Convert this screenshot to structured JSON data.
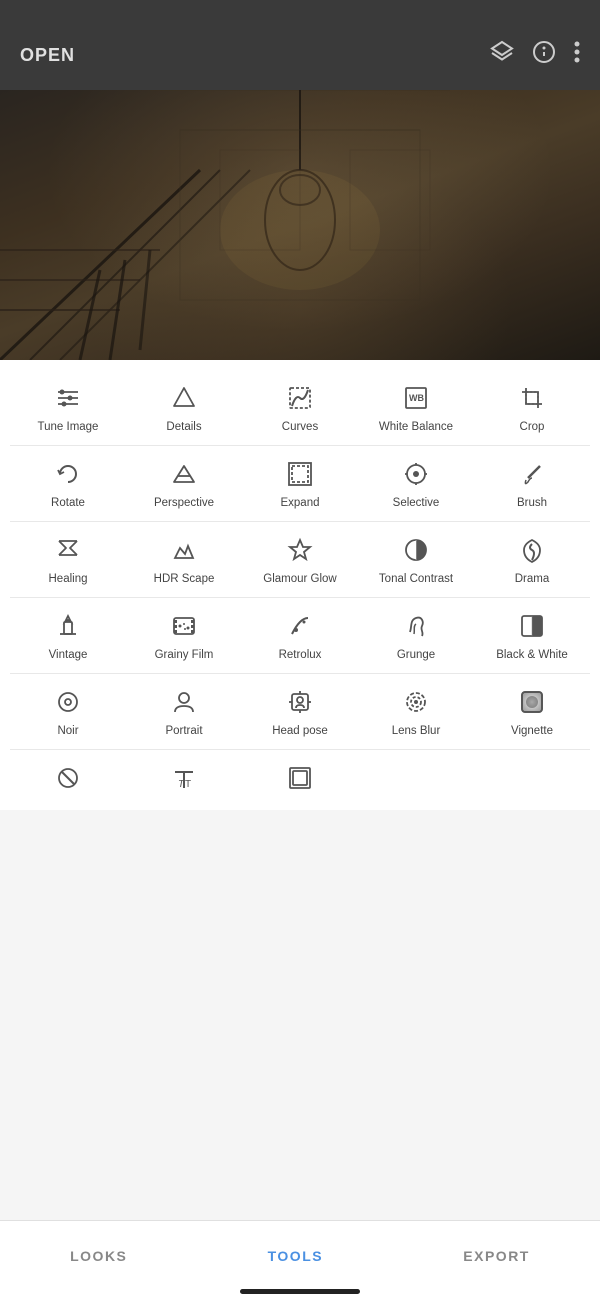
{
  "header": {
    "open_label": "OPEN",
    "layers_icon": "layers",
    "info_icon": "info",
    "more_icon": "more"
  },
  "bottom_nav": {
    "looks": "LOOKS",
    "tools": "TOOLS",
    "export": "EXPORT"
  },
  "tools": [
    {
      "id": "tune-image",
      "label": "Tune Image",
      "icon": "tune"
    },
    {
      "id": "details",
      "label": "Details",
      "icon": "details"
    },
    {
      "id": "curves",
      "label": "Curves",
      "icon": "curves"
    },
    {
      "id": "white-balance",
      "label": "White Balance",
      "icon": "wb"
    },
    {
      "id": "crop",
      "label": "Crop",
      "icon": "crop"
    },
    {
      "id": "rotate",
      "label": "Rotate",
      "icon": "rotate"
    },
    {
      "id": "perspective",
      "label": "Perspective",
      "icon": "perspective"
    },
    {
      "id": "expand",
      "label": "Expand",
      "icon": "expand"
    },
    {
      "id": "selective",
      "label": "Selective",
      "icon": "selective"
    },
    {
      "id": "brush",
      "label": "Brush",
      "icon": "brush"
    },
    {
      "id": "healing",
      "label": "Healing",
      "icon": "healing"
    },
    {
      "id": "hdr-scape",
      "label": "HDR Scape",
      "icon": "hdr"
    },
    {
      "id": "glamour-glow",
      "label": "Glamour Glow",
      "icon": "glamour"
    },
    {
      "id": "tonal-contrast",
      "label": "Tonal Contrast",
      "icon": "tonal"
    },
    {
      "id": "drama",
      "label": "Drama",
      "icon": "drama"
    },
    {
      "id": "vintage",
      "label": "Vintage",
      "icon": "vintage"
    },
    {
      "id": "grainy-film",
      "label": "Grainy Film",
      "icon": "grainy"
    },
    {
      "id": "retrolux",
      "label": "Retrolux",
      "icon": "retrolux"
    },
    {
      "id": "grunge",
      "label": "Grunge",
      "icon": "grunge"
    },
    {
      "id": "black-white",
      "label": "Black & White",
      "icon": "bw"
    },
    {
      "id": "noir",
      "label": "Noir",
      "icon": "noir"
    },
    {
      "id": "portrait",
      "label": "Portrait",
      "icon": "portrait"
    },
    {
      "id": "head-pose",
      "label": "Head pose",
      "icon": "headpose"
    },
    {
      "id": "lens-blur",
      "label": "Lens Blur",
      "icon": "lensblur"
    },
    {
      "id": "vignette",
      "label": "Vignette",
      "icon": "vignette"
    },
    {
      "id": "watermark",
      "label": "",
      "icon": "watermark"
    },
    {
      "id": "text",
      "label": "",
      "icon": "text"
    },
    {
      "id": "frames",
      "label": "",
      "icon": "frames"
    }
  ]
}
